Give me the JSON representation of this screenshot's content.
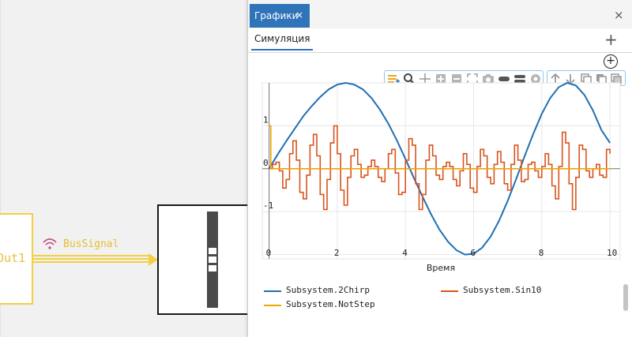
{
  "canvas": {
    "out_block_label": "Out1",
    "bus_label": "BusSignal"
  },
  "window": {
    "tab_label": "Графики",
    "tab_close_glyph": "×",
    "close_glyph": "×",
    "subtab_label": "Симуляция",
    "add_tab_glyph": "+",
    "zoom_glyph": "+"
  },
  "toolbar": {
    "group1": [
      "legend-icon",
      "zoom-icon",
      "pan-icon",
      "zoom-in-icon",
      "zoom-out-icon",
      "fit-icon",
      "camera-icon",
      "eraser-icon",
      "line-style-icon",
      "gear-icon"
    ],
    "group2": [
      "arrow-up-icon",
      "arrow-down-icon",
      "copy-icon",
      "paste-icon",
      "duplicate-icon"
    ],
    "accent_color": "#2f73b8",
    "legend_icon_color": "#e6a817"
  },
  "chart_data": {
    "type": "line",
    "xlabel": "Время",
    "xlim": [
      -0.2,
      10.3
    ],
    "ylim": [
      -2.1,
      2.0
    ],
    "x_ticks": [
      "0",
      "2",
      "4",
      "6",
      "8",
      "10"
    ],
    "y_ticks": [
      "1",
      "0",
      "-1"
    ],
    "grid": true,
    "legend_position": "bottom",
    "series": [
      {
        "name": "Subsystem.2Chirp",
        "color": "#1f6fb2",
        "x": [
          0,
          0.25,
          0.5,
          0.75,
          1,
          1.25,
          1.5,
          1.75,
          2,
          2.25,
          2.5,
          2.75,
          3,
          3.25,
          3.5,
          3.75,
          4,
          4.25,
          4.5,
          4.75,
          5,
          5.25,
          5.5,
          5.75,
          6,
          6.25,
          6.5,
          6.75,
          7,
          7.25,
          7.5,
          7.75,
          8,
          8.25,
          8.5,
          8.75,
          9,
          9.25,
          9.5,
          9.75,
          10
        ],
        "values": [
          0,
          0.33,
          0.64,
          0.93,
          1.22,
          1.46,
          1.67,
          1.85,
          1.96,
          2.0,
          1.96,
          1.85,
          1.65,
          1.38,
          1.05,
          0.66,
          0.23,
          -0.22,
          -0.65,
          -1.06,
          -1.42,
          -1.7,
          -1.9,
          -2.0,
          -1.98,
          -1.84,
          -1.58,
          -1.21,
          -0.75,
          -0.24,
          0.3,
          0.81,
          1.28,
          1.65,
          1.9,
          2.0,
          1.94,
          1.72,
          1.36,
          0.9,
          0.6
        ]
      },
      {
        "name": "Subsystem.Sin10",
        "color": "#d9531e",
        "step": true,
        "x": [
          0,
          0.1,
          0.2,
          0.3,
          0.4,
          0.5,
          0.6,
          0.7,
          0.8,
          0.9,
          1.0,
          1.1,
          1.2,
          1.3,
          1.4,
          1.5,
          1.6,
          1.7,
          1.8,
          1.9,
          2.0,
          2.1,
          2.2,
          2.3,
          2.4,
          2.5,
          2.6,
          2.7,
          2.8,
          2.9,
          3.0,
          3.1,
          3.2,
          3.3,
          3.4,
          3.5,
          3.6,
          3.7,
          3.8,
          3.9,
          4.0,
          4.1,
          4.2,
          4.3,
          4.4,
          4.5,
          4.6,
          4.7,
          4.8,
          4.9,
          5.0,
          5.1,
          5.2,
          5.3,
          5.4,
          5.5,
          5.6,
          5.7,
          5.8,
          5.9,
          6.0,
          6.1,
          6.2,
          6.3,
          6.4,
          6.5,
          6.6,
          6.7,
          6.8,
          6.9,
          7.0,
          7.1,
          7.2,
          7.3,
          7.4,
          7.5,
          7.6,
          7.7,
          7.8,
          7.9,
          8.0,
          8.1,
          8.2,
          8.3,
          8.4,
          8.5,
          8.6,
          8.7,
          8.8,
          8.9,
          9.0,
          9.1,
          9.2,
          9.3,
          9.4,
          9.5,
          9.6,
          9.7,
          9.8,
          9.9,
          10.0
        ],
        "values": [
          0,
          0.1,
          0.15,
          -0.05,
          -0.45,
          -0.25,
          0.35,
          0.65,
          0.2,
          -0.55,
          -0.7,
          -0.15,
          0.55,
          0.8,
          0.3,
          -0.6,
          -0.95,
          -0.25,
          0.6,
          1.0,
          0.35,
          -0.5,
          -0.85,
          -0.2,
          0.3,
          0.45,
          0.1,
          -0.2,
          -0.15,
          0.05,
          0.2,
          0.05,
          -0.2,
          -0.3,
          0,
          0.35,
          0.45,
          -0.1,
          -0.6,
          -0.55,
          0.2,
          0.7,
          0.55,
          -0.35,
          -0.95,
          -0.6,
          0.2,
          0.55,
          0.3,
          -0.15,
          -0.25,
          0.05,
          0.15,
          0.05,
          -0.25,
          -0.4,
          -0.05,
          0.35,
          0.1,
          -0.45,
          -0.55,
          0.05,
          0.45,
          0.3,
          -0.2,
          -0.35,
          0.1,
          0.4,
          0.15,
          -0.35,
          -0.5,
          0.1,
          0.55,
          0.2,
          -0.3,
          -0.25,
          0.1,
          0.15,
          -0.05,
          -0.2,
          0.05,
          0.35,
          0.1,
          -0.4,
          -0.7,
          0.05,
          0.85,
          0.6,
          -0.35,
          -0.95,
          -0.2,
          0.55,
          0.45,
          -0.05,
          -0.2,
          0,
          0.1,
          -0.15,
          -0.2,
          0.45,
          0.35
        ]
      },
      {
        "name": "Subsystem.NotStep",
        "color": "#f0a500",
        "step": true,
        "x": [
          0,
          0.05,
          0.05,
          10
        ],
        "values": [
          1,
          1,
          0,
          0
        ]
      }
    ]
  }
}
